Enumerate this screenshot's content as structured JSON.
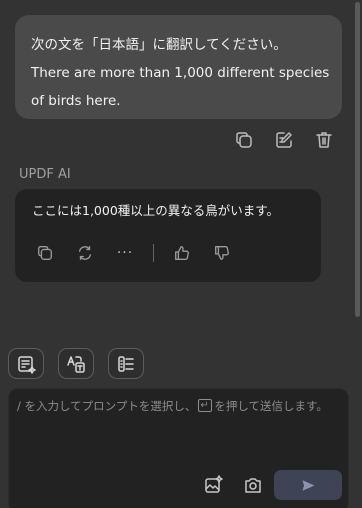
{
  "user_message": {
    "lines": [
      "次の文を「日本語」に翻訳してください。",
      "There are more than 1,000 different species",
      "of birds here."
    ]
  },
  "assistant": {
    "name": "UPDF AI",
    "reply": "ここには1,000種以上の異なる鳥がいます。",
    "more_label": "···"
  },
  "input": {
    "placeholder_before": "/ を入力してプロンプトを選択し、",
    "placeholder_after": "を押して送信します。"
  },
  "icons": {
    "user_actions": [
      "copy-icon",
      "edit-icon",
      "trash-icon"
    ],
    "ai_actions": [
      "copy-icon",
      "regenerate-icon",
      "more-icon",
      "thumbs-up-icon",
      "thumbs-down-icon"
    ],
    "tools": [
      "summarize-icon",
      "translate-icon",
      "explain-icon"
    ],
    "input_tools": [
      "image-sparkle-icon",
      "camera-icon",
      "send-icon"
    ]
  }
}
